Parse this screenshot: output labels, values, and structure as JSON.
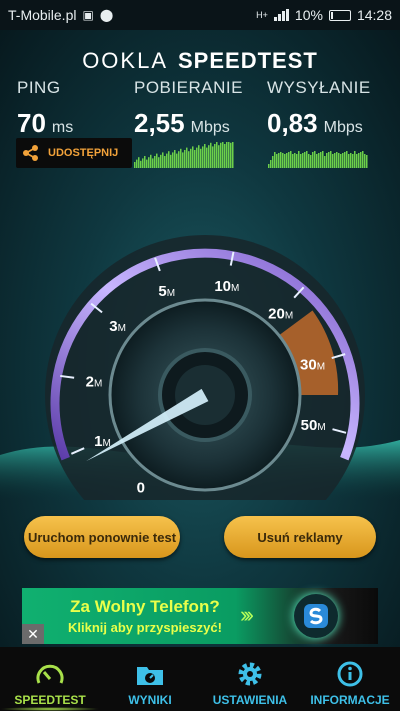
{
  "status": {
    "carrier": "T-Mobile.pl",
    "network": "H+",
    "battery": "10%",
    "battery_level": 0.1,
    "time": "14:28"
  },
  "header": {
    "brand_left": "OOKLA",
    "brand_right": "SPEEDTEST"
  },
  "metrics": {
    "ping": {
      "label": "PING",
      "value": "70",
      "unit": "ms"
    },
    "download": {
      "label": "POBIERANIE",
      "value": "2,55",
      "unit": "Mbps"
    },
    "upload": {
      "label": "WYSYŁANIE",
      "value": "0,83",
      "unit": "Mbps"
    }
  },
  "share": {
    "label": "UDOSTĘPNIJ"
  },
  "gauge": {
    "ticks": [
      {
        "num": "0",
        "unit": ""
      },
      {
        "num": "1",
        "unit": "M"
      },
      {
        "num": "2",
        "unit": "M"
      },
      {
        "num": "3",
        "unit": "M"
      },
      {
        "num": "5",
        "unit": "M"
      },
      {
        "num": "10",
        "unit": "M"
      },
      {
        "num": "20",
        "unit": "M"
      },
      {
        "num": "30",
        "unit": "M"
      },
      {
        "num": "50",
        "unit": "M"
      }
    ],
    "needle_value_mbps": 0.83
  },
  "buttons": {
    "retest": "Uruchom ponownie test",
    "remove_ads": "Usuń reklamy"
  },
  "ad": {
    "title": "Za Wolny Telefon?",
    "subtitle": "Kliknij aby przyspieszyć!",
    "close": "✕"
  },
  "nav": [
    {
      "label": "SPEEDTEST",
      "icon": "gauge-icon"
    },
    {
      "label": "WYNIKI",
      "icon": "results-folder-icon"
    },
    {
      "label": "USTAWIENIA",
      "icon": "gear-icon"
    },
    {
      "label": "INFORMACJE",
      "icon": "info-icon"
    }
  ],
  "colors": {
    "accent_orange": "#f2a23a",
    "nav_blue": "#3ec0e8",
    "nav_active": "#a8e04a",
    "button_gold": "#f6c24c"
  }
}
